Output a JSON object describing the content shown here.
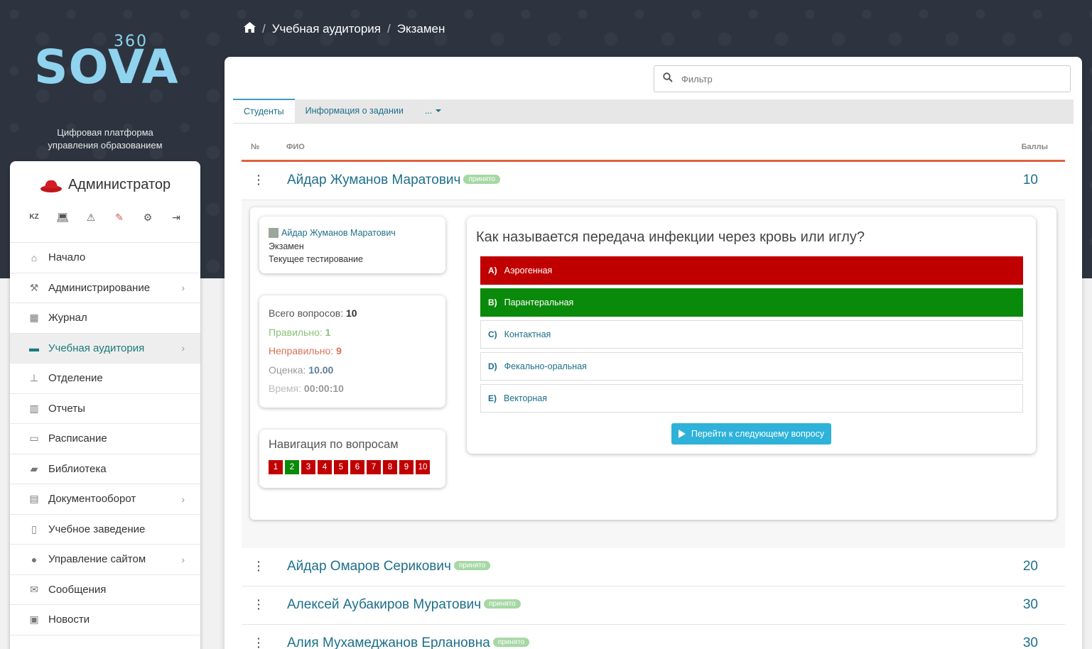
{
  "brand": {
    "name": "SOVA",
    "number": "360",
    "tagline_1": "Цифровая платформа",
    "tagline_2": "управления образованием"
  },
  "breadcrumb": {
    "items": [
      "Учебная аудитория",
      "Экзамен"
    ]
  },
  "sidebar": {
    "role": "Администратор",
    "tools": {
      "lang": "KZ"
    },
    "items": [
      {
        "label": "Начало",
        "icon": "home-icon"
      },
      {
        "label": "Администрирование",
        "icon": "gavel-icon",
        "has_submenu": true
      },
      {
        "label": "Журнал",
        "icon": "table-icon"
      },
      {
        "label": "Учебная аудитория",
        "icon": "presentation-icon",
        "has_submenu": true,
        "active": true
      },
      {
        "label": "Отделение",
        "icon": "sitemap-icon"
      },
      {
        "label": "Отчеты",
        "icon": "bar-chart-icon"
      },
      {
        "label": "Расписание",
        "icon": "calendar-icon"
      },
      {
        "label": "Библиотека",
        "icon": "book-icon"
      },
      {
        "label": "Документооборот",
        "icon": "document-icon",
        "has_submenu": true
      },
      {
        "label": "Учебное заведение",
        "icon": "building-icon"
      },
      {
        "label": "Управление сайтом",
        "icon": "globe-icon",
        "has_submenu": true
      },
      {
        "label": "Сообщения",
        "icon": "envelope-icon"
      },
      {
        "label": "Новости",
        "icon": "newspaper-icon"
      }
    ]
  },
  "filter": {
    "placeholder": "Фильтр"
  },
  "tabs": [
    {
      "label": "Студенты",
      "active": true
    },
    {
      "label": "Информация о задании"
    },
    {
      "label": "..."
    }
  ],
  "table": {
    "headers": {
      "num": "№",
      "name": "ФИО",
      "score": "Баллы"
    },
    "rows": [
      {
        "name": "Айдар Жуманов Маратович",
        "status": "принято",
        "score": "10"
      },
      {
        "name": "Айдар Омаров Серикович",
        "status": "принято",
        "score": "20"
      },
      {
        "name": "Алексей Аубакиров Муратович",
        "status": "принято",
        "score": "30"
      },
      {
        "name": "Алия Мухамеджанов Ерлановна",
        "status": "принято",
        "score": "30"
      }
    ]
  },
  "detail": {
    "student": "Айдар Жуманов Маратович",
    "exam": "Экзамен",
    "state": "Текущее тестирование",
    "stats": {
      "total_label": "Всего вопросов:",
      "total": "10",
      "right_label": "Правильно:",
      "right": "1",
      "wrong_label": "Неправильно:",
      "wrong": "9",
      "grade_label": "Оценка:",
      "grade": "10.00",
      "time_label": "Время:",
      "time": "00:00:10"
    },
    "nav_title": "Навигация по вопросам",
    "nav_numbers": [
      "1",
      "2",
      "3",
      "4",
      "5",
      "6",
      "7",
      "8",
      "9",
      "10"
    ],
    "nav_correct_index": 1,
    "question": "Как называется передача инфекции через кровь или иглу?",
    "answers": [
      {
        "letter": "A)",
        "text": "Аэрогенная",
        "state": "wrong"
      },
      {
        "letter": "B)",
        "text": "Парантеральная",
        "state": "right"
      },
      {
        "letter": "C)",
        "text": "Контактная",
        "state": "none"
      },
      {
        "letter": "D)",
        "text": "Фекально-оральная",
        "state": "none"
      },
      {
        "letter": "E)",
        "text": "Векторная",
        "state": "none"
      }
    ],
    "next_button": "Перейти к следующему вопросу"
  },
  "colors": {
    "accent": "#1d6f8a",
    "wrong": "#c00000",
    "right": "#0a8a0a",
    "header_line": "#e2603c",
    "button": "#2eb2d9"
  }
}
